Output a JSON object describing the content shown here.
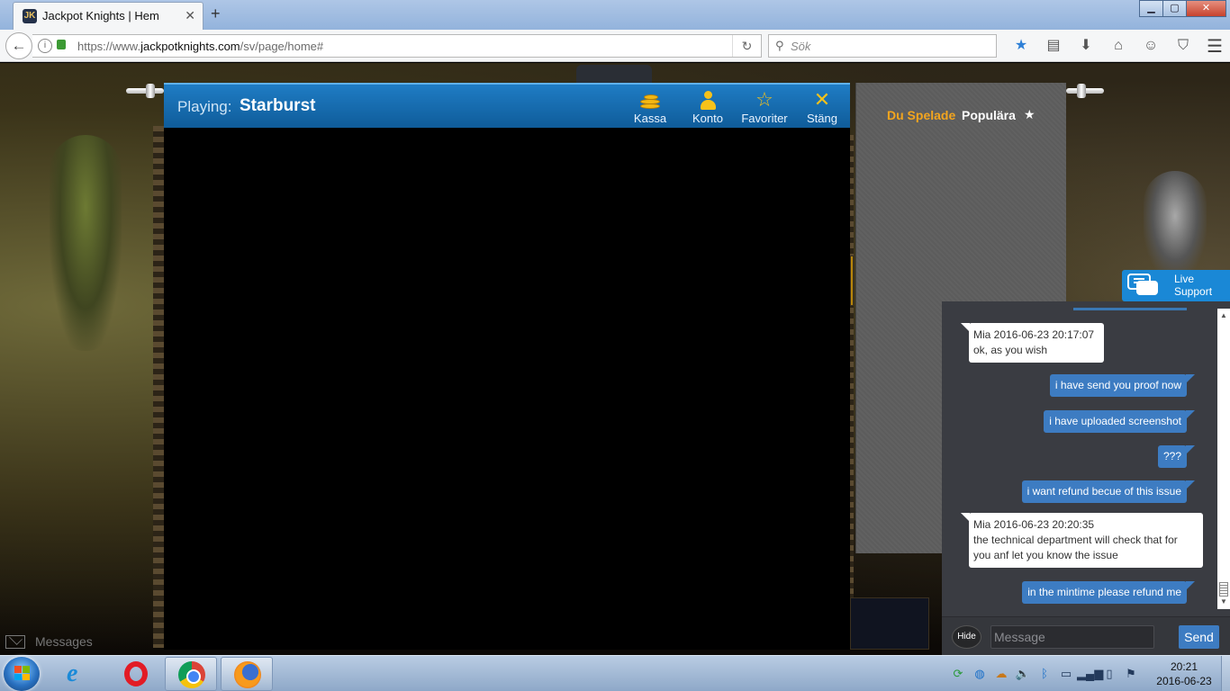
{
  "browser": {
    "tab_title": "Jackpot Knights | Hem",
    "tab_favicon": "JK",
    "new_tab_label": "+",
    "url_prefix": "https://www.",
    "url_domain": "jackpotknights.com",
    "url_path": "/sv/page/home#",
    "search_placeholder": "Sök",
    "window": {
      "minimize": "▁",
      "maximize": "▢",
      "close": "✕"
    },
    "toolbar_icons": [
      "bookmark-star-icon",
      "reading-list-icon",
      "download-icon",
      "home-icon",
      "chat-icon",
      "pocket-icon"
    ]
  },
  "game": {
    "playing_label": "Playing:",
    "game_name": "Starburst",
    "actions": [
      {
        "label": "Kassa",
        "icon": "coins-icon"
      },
      {
        "label": "Konto",
        "icon": "person-icon"
      },
      {
        "label": "Favoriter",
        "icon": "star-outline-icon"
      },
      {
        "label": "Stäng",
        "icon": "close-x-icon"
      }
    ]
  },
  "side_panel": {
    "tab_played": "Du Spelade",
    "tab_popular": "Populära",
    "star": "★"
  },
  "live_support": {
    "line1": "Live",
    "line2": "Support"
  },
  "chat": {
    "messages": [
      {
        "from": "agent",
        "header": "Mia 2016-06-23 20:17:07",
        "text": "ok, as you wish"
      },
      {
        "from": "user",
        "text": "i have send you proof now"
      },
      {
        "from": "user",
        "text": "i have uploaded screenshot"
      },
      {
        "from": "user",
        "text": "???"
      },
      {
        "from": "user",
        "text": "i want refund becue of this issue"
      },
      {
        "from": "agent",
        "header": "Mia 2016-06-23 20:20:35",
        "text1": "the technical department will check that for",
        "text2": "you anf let you know the issue"
      },
      {
        "from": "user",
        "text": "in the mintime please refund me"
      }
    ],
    "hide_label": "Hide",
    "input_placeholder": "Message",
    "send_label": "Send"
  },
  "messages_tab": {
    "label": "Messages"
  },
  "taskbar": {
    "clock_time": "20:21",
    "clock_date": "2016-06-23",
    "apps": [
      "internet-explorer",
      "opera",
      "chrome",
      "firefox"
    ]
  },
  "colors": {
    "game_header_blue": "#1f7cc4",
    "tab_active_orange": "#f3a51e",
    "chat_user_bubble": "#3d7cc2",
    "live_support_blue": "#1a88d6"
  }
}
